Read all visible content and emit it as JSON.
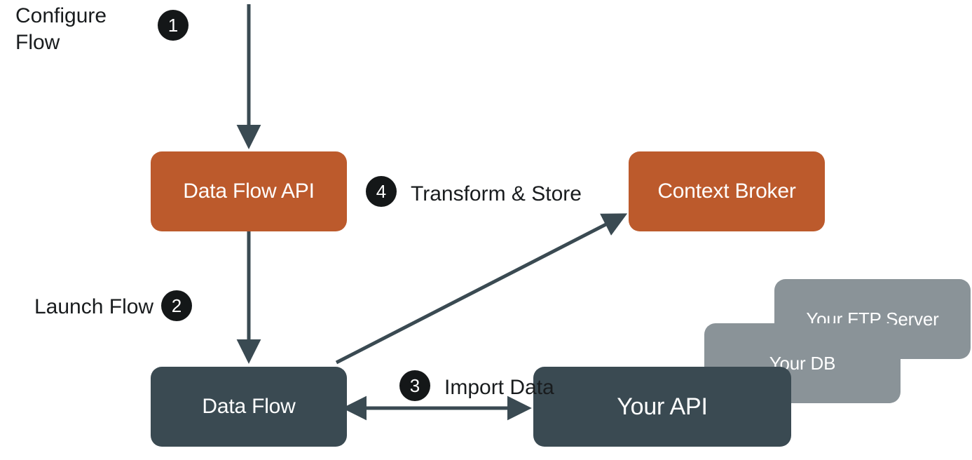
{
  "boxes": {
    "data_flow_api": {
      "label": "Data Flow API"
    },
    "context_broker": {
      "label": "Context Broker"
    },
    "data_flow": {
      "label": "Data Flow"
    },
    "your_api": {
      "label": "Your API"
    },
    "your_db": {
      "label": "Your DB"
    },
    "your_ftp": {
      "label": "Your FTP Server"
    }
  },
  "labels": {
    "configure_flow": "Configure\nFlow",
    "launch_flow": "Launch Flow",
    "import_data": "Import Data",
    "transform_store": "Transform & Store"
  },
  "badges": {
    "b1": "1",
    "b2": "2",
    "b3": "3",
    "b4": "4"
  },
  "colors": {
    "orange": "#bc5a2c",
    "dark": "#3a4a52",
    "gray": "#8a9398",
    "arrow": "#3a4a52",
    "badge_bg": "#141718",
    "text": "#191c1e",
    "white": "#ffffff"
  }
}
